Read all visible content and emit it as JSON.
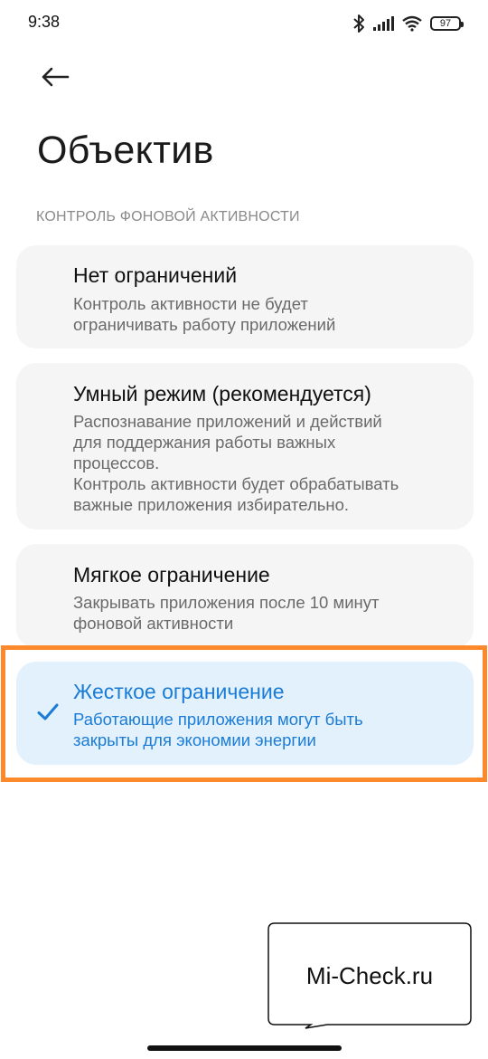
{
  "status_bar": {
    "time": "9:38",
    "battery": "97",
    "icons": [
      "bluetooth-icon",
      "signal-icon",
      "wifi-icon",
      "battery-icon"
    ]
  },
  "header": {
    "back_icon": "arrow-left-icon",
    "title": "Объектив"
  },
  "section": {
    "label": "КОНТРОЛЬ ФОНОВОЙ АКТИВНОСТИ"
  },
  "options": [
    {
      "title": "Нет ограничений",
      "description": "Контроль активности не будет\nограничивать работу приложений",
      "selected": false
    },
    {
      "title": "Умный режим (рекомендуется)",
      "description": "Распознавание приложений и действий\nдля поддержания работы важных\nпроцессов.\nКонтроль активности будет обрабатывать\nважные приложения избирательно.",
      "selected": false
    },
    {
      "title": "Мягкое ограничение",
      "description": "Закрывать приложения после 10 минут\nфоновой активности",
      "selected": false
    },
    {
      "title": "Жесткое ограничение",
      "description": "Работающие приложения могут быть\nзакрыты для экономии энергии",
      "selected": true
    }
  ],
  "watermark": {
    "text": "Mi-Check.ru"
  },
  "colors": {
    "accent": "#1a7cd6",
    "selected_background": "#e3f1fd",
    "card_background": "#f5f5f5",
    "highlight": "#fc8a2c"
  }
}
